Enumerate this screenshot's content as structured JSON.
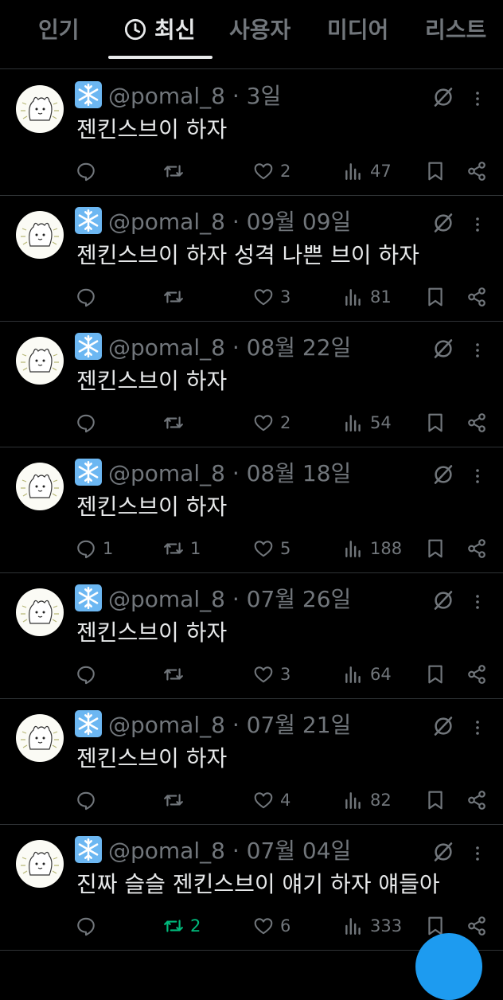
{
  "tabs": [
    {
      "label": "인기",
      "active": false
    },
    {
      "label": "최신",
      "active": true,
      "icon": "clock-icon"
    },
    {
      "label": "사용자",
      "active": false
    },
    {
      "label": "미디어",
      "active": false
    },
    {
      "label": "리스트",
      "active": false
    }
  ],
  "colors": {
    "background": "#000000",
    "text": "#e7e9ea",
    "muted": "#71767b",
    "retweet_active": "#00ba7c",
    "accent": "#1d9bf0"
  },
  "author": {
    "handle": "@pomal_8",
    "emoji": "snowflake-icon"
  },
  "posts": [
    {
      "date": "3일",
      "text": "젠킨스브이 하자",
      "replies": "",
      "retweets": "",
      "likes": "2",
      "views": "47",
      "retweeted": false
    },
    {
      "date": "09월 09일",
      "text": "젠킨스브이 하자 성격 나쁜 브이 하자",
      "replies": "",
      "retweets": "",
      "likes": "3",
      "views": "81",
      "retweeted": false
    },
    {
      "date": "08월 22일",
      "text": "젠킨스브이 하자",
      "replies": "",
      "retweets": "",
      "likes": "2",
      "views": "54",
      "retweeted": false
    },
    {
      "date": "08월 18일",
      "text": "젠킨스브이 하자",
      "replies": "1",
      "retweets": "1",
      "likes": "5",
      "views": "188",
      "retweeted": false
    },
    {
      "date": "07월 26일",
      "text": "젠킨스브이 하자",
      "replies": "",
      "retweets": "",
      "likes": "3",
      "views": "64",
      "retweeted": false
    },
    {
      "date": "07월 21일",
      "text": "젠킨스브이 하자",
      "replies": "",
      "retweets": "",
      "likes": "4",
      "views": "82",
      "retweeted": false
    },
    {
      "date": "07월 04일",
      "text": "진짜 슬슬 젠킨스브이 얘기 하자 얘들아",
      "replies": "",
      "retweets": "2",
      "likes": "6",
      "views": "333",
      "retweeted": true
    }
  ]
}
